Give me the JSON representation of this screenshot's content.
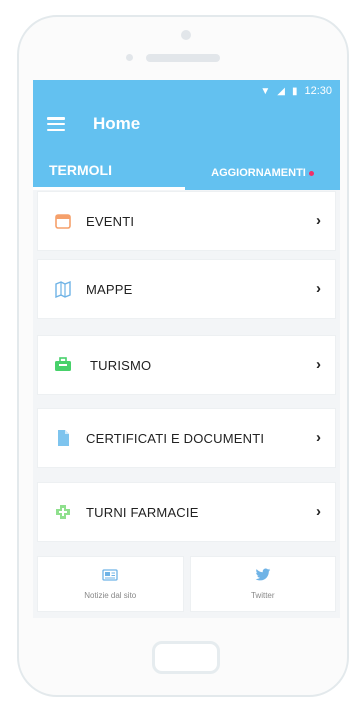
{
  "status_bar": {
    "time": "12:30"
  },
  "header": {
    "title": "Home"
  },
  "tabs": [
    {
      "label": "TERMOLI"
    },
    {
      "label": "AGGIORNAMENTI"
    }
  ],
  "menu": [
    {
      "label": "EVENTI"
    },
    {
      "label": "MAPPE"
    },
    {
      "label": "TURISMO"
    },
    {
      "label": "CERTIFICATI E DOCUMENTI"
    },
    {
      "label": "TURNI FARMACIE"
    }
  ],
  "bottom": [
    {
      "label": "Notizie dal sito"
    },
    {
      "label": "Twitter"
    }
  ],
  "colors": {
    "accent": "#63c1f0",
    "badge": "#f0306a"
  }
}
